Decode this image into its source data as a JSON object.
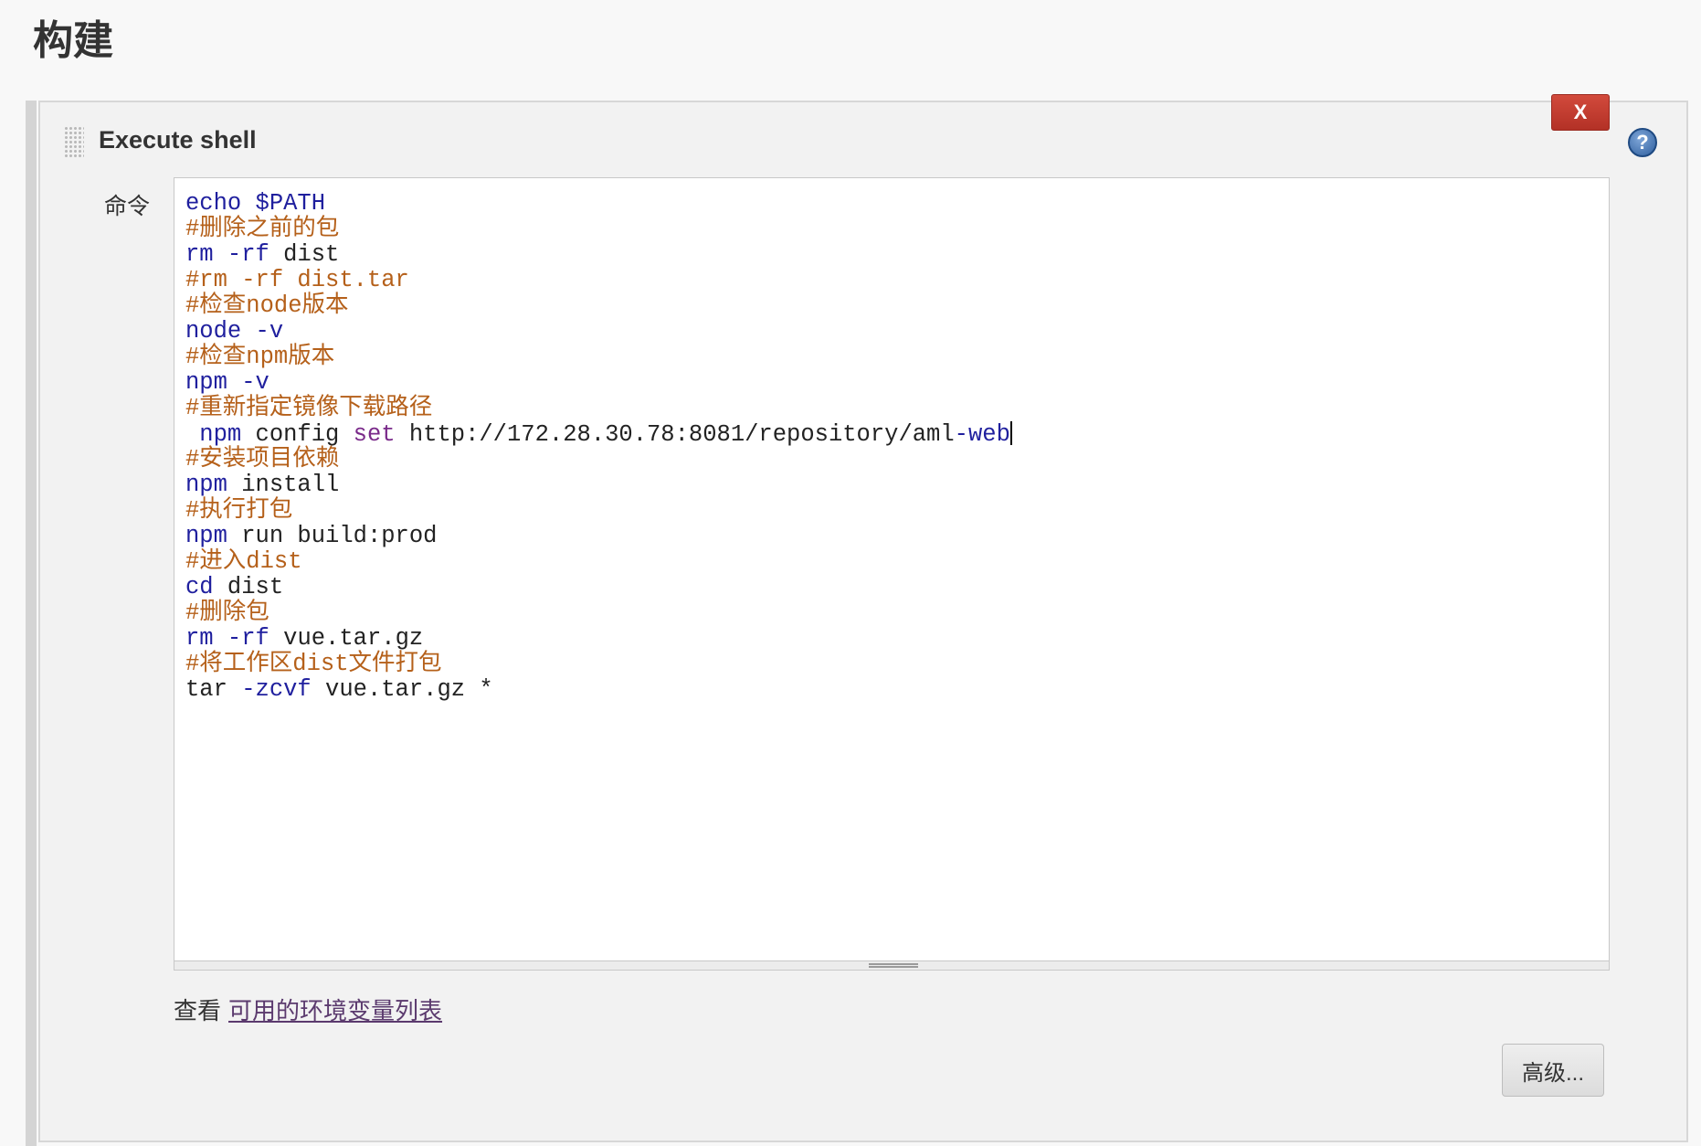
{
  "section": {
    "title": "构建"
  },
  "step": {
    "title": "Execute shell",
    "close_label": "X",
    "help_label": "?",
    "field_label": "命令"
  },
  "editor": {
    "lines": [
      [
        {
          "t": "cmd",
          "v": "echo "
        },
        {
          "t": "var",
          "v": "$PATH"
        }
      ],
      [
        {
          "t": "cmt",
          "v": "#删除之前的包"
        }
      ],
      [
        {
          "t": "cmd",
          "v": "rm "
        },
        {
          "t": "flag",
          "v": "-rf"
        },
        {
          "t": "plain",
          "v": " dist"
        }
      ],
      [
        {
          "t": "cmt",
          "v": "#rm -rf dist.tar"
        }
      ],
      [
        {
          "t": "cmt",
          "v": "#检查node版本"
        }
      ],
      [
        {
          "t": "cmd",
          "v": "node "
        },
        {
          "t": "flag",
          "v": "-v"
        }
      ],
      [
        {
          "t": "cmt",
          "v": "#检查npm版本"
        }
      ],
      [
        {
          "t": "cmd",
          "v": "npm "
        },
        {
          "t": "flag",
          "v": "-v"
        }
      ],
      [
        {
          "t": "cmt",
          "v": "#重新指定镜像下载路径"
        }
      ],
      [
        {
          "t": "cmd",
          "v": " npm "
        },
        {
          "t": "plain",
          "v": "config "
        },
        {
          "t": "kw",
          "v": "set"
        },
        {
          "t": "plain",
          "v": " http://172.28.30.78:8081/repository/aml"
        },
        {
          "t": "flag",
          "v": "-web"
        },
        {
          "t": "caret",
          "v": ""
        }
      ],
      [
        {
          "t": "cmt",
          "v": "#安装项目依赖"
        }
      ],
      [
        {
          "t": "cmd",
          "v": "npm "
        },
        {
          "t": "plain",
          "v": "install"
        }
      ],
      [
        {
          "t": "cmt",
          "v": "#执行打包"
        }
      ],
      [
        {
          "t": "cmd",
          "v": "npm "
        },
        {
          "t": "plain",
          "v": "run build:prod"
        }
      ],
      [
        {
          "t": "cmt",
          "v": "#进入dist"
        }
      ],
      [
        {
          "t": "cmd",
          "v": "cd "
        },
        {
          "t": "plain",
          "v": "dist"
        }
      ],
      [
        {
          "t": "cmt",
          "v": "#删除包"
        }
      ],
      [
        {
          "t": "cmd",
          "v": "rm "
        },
        {
          "t": "flag",
          "v": "-rf"
        },
        {
          "t": "plain",
          "v": " vue.tar.gz"
        }
      ],
      [
        {
          "t": "cmt",
          "v": "#将工作区dist文件打包"
        }
      ],
      [
        {
          "t": "plain",
          "v": "tar "
        },
        {
          "t": "flag",
          "v": "-zcvf"
        },
        {
          "t": "plain",
          "v": " vue.tar.gz *"
        }
      ]
    ]
  },
  "env": {
    "prefix": "查看",
    "link_text": "可用的环境变量列表"
  },
  "advanced": {
    "label": "高级..."
  },
  "colors": {
    "command": "#1f1f9e",
    "keyword": "#7a2a8a",
    "comment": "#b5601a",
    "close_button": "#c0392b",
    "link": "#5b3a6e"
  }
}
